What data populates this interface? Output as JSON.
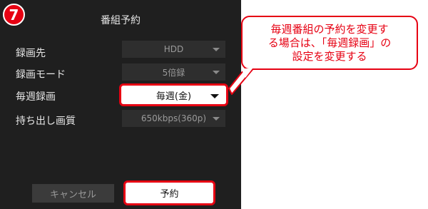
{
  "step": {
    "number": "7"
  },
  "dialog": {
    "title": "番組予約",
    "rows": [
      {
        "label": "録画先",
        "value": "HDD"
      },
      {
        "label": "録画モード",
        "value": "5倍録"
      },
      {
        "label": "毎週録画",
        "value": "毎週(金)"
      },
      {
        "label": "持ち出し画質",
        "value": "650kbps(360p)"
      }
    ],
    "buttons": {
      "cancel": "キャンセル",
      "reserve": "予約"
    }
  },
  "callout": {
    "lines": [
      "毎週番組の予約を変更す",
      "る場合は、「毎週録画」の",
      "設定を変更する"
    ]
  },
  "colors": {
    "accent": "#e60012",
    "dialog_bg": "#1f1f1f"
  }
}
